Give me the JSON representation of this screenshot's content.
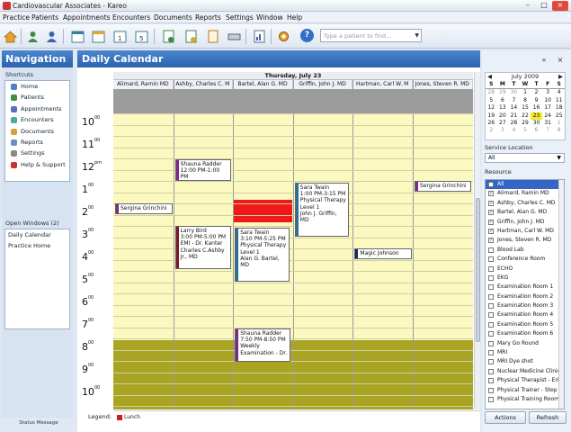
{
  "window": {
    "title": "Cardiovascular Associates - Kareo"
  },
  "menu": [
    "Practice",
    "Patients",
    "Appointments",
    "Encounters",
    "Documents",
    "Reports",
    "Settings",
    "Window",
    "Help"
  ],
  "search": {
    "placeholder": "Type a patient to find..."
  },
  "nav": {
    "title": "Navigation",
    "shortcuts_label": "Shortcuts",
    "shortcuts": [
      {
        "label": "Home",
        "color": "#4a7fc9"
      },
      {
        "label": "Patients",
        "color": "#3e8f4a"
      },
      {
        "label": "Appointments",
        "color": "#5a6fb8"
      },
      {
        "label": "Encounters",
        "color": "#4aa9a0"
      },
      {
        "label": "Documents",
        "color": "#d4a43a"
      },
      {
        "label": "Reports",
        "color": "#6b8fc4"
      },
      {
        "label": "Settings",
        "color": "#888888"
      },
      {
        "label": "Help & Support",
        "color": "#cc3333"
      }
    ],
    "open_windows_label": "Open Windows (2)",
    "open_windows": [
      "Daily Calendar",
      "Practice Home"
    ],
    "status_message": "Status Message"
  },
  "calendar": {
    "title": "Daily Calendar",
    "date": "Thursday, July 23",
    "providers": [
      "Alimard, Ramin MD",
      "Ashby, Charles C. M",
      "Bartel, Alan G. MD",
      "Griffin, John J. MD",
      "Hartman, Carl W. M",
      "Jones, Steven R. MD"
    ],
    "hours": [
      {
        "h": "10",
        "m": "00"
      },
      {
        "h": "11",
        "m": "00"
      },
      {
        "h": "12",
        "m": "pm"
      },
      {
        "h": "1",
        "m": "00"
      },
      {
        "h": "2",
        "m": "00"
      },
      {
        "h": "3",
        "m": "00"
      },
      {
        "h": "4",
        "m": "00"
      },
      {
        "h": "5",
        "m": "00"
      },
      {
        "h": "6",
        "m": "00"
      },
      {
        "h": "7",
        "m": "00"
      },
      {
        "h": "8",
        "m": "00"
      },
      {
        "h": "9",
        "m": "00"
      },
      {
        "h": "10",
        "m": "00"
      }
    ],
    "appointments": [
      {
        "lines": [
          "Sergina Grinchini"
        ],
        "color": "#7a2a8a"
      },
      {
        "lines": [
          "Shauna Radder",
          "12:00 PM-1:00",
          "PM"
        ],
        "color": "#7a2a8a"
      },
      {
        "lines": [
          "Larry Bird",
          "3:00 PM-5:00 PM",
          "EMI - Dr. Kanter",
          "Charles C.Ashby",
          "Jr., MD"
        ],
        "color": "#7a1a2a"
      },
      {
        "lines": [
          "Sara Twain",
          "3:10 PM-5:25 PM",
          "Physical Therapy",
          "Level 1",
          "Alan G. Bartel,",
          "MD"
        ],
        "color": "#2c6e9a"
      },
      {
        "lines": [
          "Shauna Radder",
          "7:50 PM-8:50 PM",
          "Weekly",
          "Examination - Dr."
        ],
        "color": "#7a2a8a"
      },
      {
        "lines": [
          "Sara Twain",
          "1:00 PM-3:15 PM",
          "Physical Therapy",
          "Level 1",
          "John J. Griffin,",
          "MD"
        ],
        "color": "#2c6e9a"
      },
      {
        "lines": [
          "Magic Johnson"
        ],
        "color": "#1a2a5a"
      },
      {
        "lines": [
          "Sergina Grinchini"
        ],
        "color": "#7a2a8a"
      }
    ],
    "legend_label": "Legend:",
    "legend_item": "Lunch"
  },
  "mini_calendar": {
    "month": "July 2009",
    "dow": [
      "S",
      "M",
      "T",
      "W",
      "T",
      "F",
      "S"
    ],
    "weeks": [
      [
        {
          "d": "28",
          "dim": true
        },
        {
          "d": "29",
          "dim": true
        },
        {
          "d": "30",
          "dim": true
        },
        {
          "d": "1"
        },
        {
          "d": "2"
        },
        {
          "d": "3"
        },
        {
          "d": "4"
        }
      ],
      [
        {
          "d": "5"
        },
        {
          "d": "6"
        },
        {
          "d": "7"
        },
        {
          "d": "8"
        },
        {
          "d": "9"
        },
        {
          "d": "10"
        },
        {
          "d": "11"
        }
      ],
      [
        {
          "d": "12"
        },
        {
          "d": "13"
        },
        {
          "d": "14"
        },
        {
          "d": "15"
        },
        {
          "d": "16"
        },
        {
          "d": "17"
        },
        {
          "d": "18"
        }
      ],
      [
        {
          "d": "19"
        },
        {
          "d": "20"
        },
        {
          "d": "21"
        },
        {
          "d": "22"
        },
        {
          "d": "23",
          "hl": true
        },
        {
          "d": "24"
        },
        {
          "d": "25"
        }
      ],
      [
        {
          "d": "26"
        },
        {
          "d": "27"
        },
        {
          "d": "28"
        },
        {
          "d": "29"
        },
        {
          "d": "30"
        },
        {
          "d": "31"
        },
        {
          "d": "1",
          "dim": true
        }
      ],
      [
        {
          "d": "2",
          "dim": true
        },
        {
          "d": "3",
          "dim": true
        },
        {
          "d": "4",
          "dim": true
        },
        {
          "d": "5",
          "dim": true
        },
        {
          "d": "6",
          "dim": true
        },
        {
          "d": "7",
          "dim": true
        },
        {
          "d": "8",
          "dim": true
        }
      ]
    ]
  },
  "service_location": {
    "label": "Service Location",
    "value": "All"
  },
  "resource": {
    "label": "Resource",
    "items": [
      {
        "name": "All",
        "checked": false,
        "selected": true
      },
      {
        "name": "Alimard, Ramin MD",
        "checked": true
      },
      {
        "name": "Ashby, Charles C. MD",
        "checked": true
      },
      {
        "name": "Bartel, Alan G. MD",
        "checked": true
      },
      {
        "name": "Griffin, John J. MD",
        "checked": true
      },
      {
        "name": "Hartman, Carl W. MD",
        "checked": true
      },
      {
        "name": "Jones, Steven R. MD",
        "checked": true
      },
      {
        "name": "Blood Lab",
        "checked": false
      },
      {
        "name": "Conference Room",
        "checked": false
      },
      {
        "name": "ECHO",
        "checked": false
      },
      {
        "name": "EKG",
        "checked": false
      },
      {
        "name": "Examination Room 1",
        "checked": false
      },
      {
        "name": "Examination Room 2",
        "checked": false
      },
      {
        "name": "Examination Room 3",
        "checked": false
      },
      {
        "name": "Examination Room 4",
        "checked": false
      },
      {
        "name": "Examination Room 5",
        "checked": false
      },
      {
        "name": "Examination Room 6",
        "checked": false
      },
      {
        "name": "Mary Go Round",
        "checked": false
      },
      {
        "name": "MRI",
        "checked": false
      },
      {
        "name": "MRI Dye shot",
        "checked": false
      },
      {
        "name": "Nuclear Medicine Clinic",
        "checked": false
      },
      {
        "name": "Physical Therapist - Eri",
        "checked": false
      },
      {
        "name": "Physical Trainer - Step",
        "checked": false
      },
      {
        "name": "Physical Training Room",
        "checked": false
      }
    ]
  },
  "buttons": {
    "actions": "Actions",
    "refresh": "Refresh"
  },
  "colors": {
    "header_blue": "#2b63ad",
    "work_hours": "#fbf9c0",
    "after_hours": "#a9a422",
    "lunch": "#f01818"
  }
}
